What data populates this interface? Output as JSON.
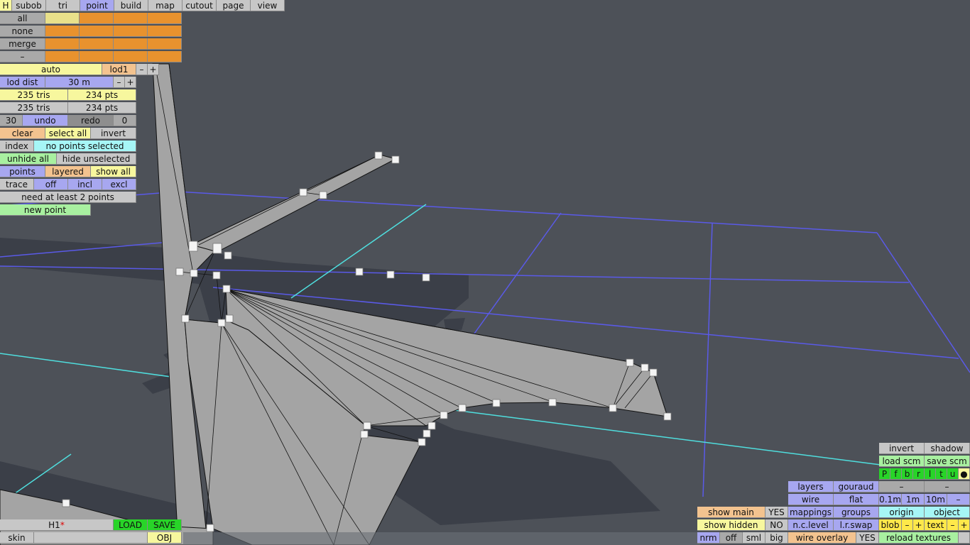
{
  "menu": {
    "h": "H",
    "tabs": [
      "subob",
      "tri",
      "point",
      "build",
      "map",
      "cutout",
      "page",
      "view"
    ],
    "active_tab": "point"
  },
  "selection": {
    "all": "all",
    "none": "none",
    "merge": "merge",
    "dash": "–"
  },
  "lod": {
    "auto": "auto",
    "lod1": "lod1",
    "minus": "–",
    "plus": "+",
    "dist_label": "lod dist",
    "dist_value": "30 m"
  },
  "stats": {
    "tris_a": "235 tris",
    "pts_a": "234 pts",
    "tris_b": "235 tris",
    "pts_b": "234 pts"
  },
  "undo": {
    "count": "30",
    "undo": "undo",
    "redo": "redo",
    "redo_count": "0"
  },
  "actions": {
    "clear": "clear",
    "select_all": "select all",
    "invert": "invert",
    "index": "index",
    "status": "no points selected",
    "unhide_all": "unhide all",
    "hide_unselected": "hide unselected",
    "points": "points",
    "layered": "layered",
    "show_all": "show all",
    "trace": "trace",
    "off": "off",
    "incl": "incl",
    "excl": "excl",
    "need_points": "need at least 2 points",
    "new_point": "new point"
  },
  "file": {
    "name": "H1",
    "modified": "*",
    "load": "LOAD",
    "save": "SAVE",
    "skin": "skin",
    "obj": "OBJ"
  },
  "view_options": {
    "show_main": "show main",
    "show_main_value": "YES",
    "show_hidden": "show hidden",
    "show_hidden_value": "NO",
    "nrm": "nrm",
    "off": "off",
    "sml": "sml",
    "big": "big",
    "layers": "layers",
    "gouraud": "gouraud",
    "wire": "wire",
    "flat": "flat",
    "mappings": "mappings",
    "groups": "groups",
    "nc_level": "n.c.level",
    "lr_swap": "l.r.swap",
    "wire_overlay": "wire overlay",
    "wire_overlay_value": "YES",
    "invert": "invert",
    "shadow": "shadow",
    "load_scm": "load scm",
    "save_scm": "save scm",
    "view_letters": [
      "P",
      "f",
      "b",
      "r",
      "l",
      "t",
      "u"
    ],
    "dot": "●",
    "dash1": "–",
    "dash2": "–",
    "grid_01": "0.1m",
    "grid_1": "1m",
    "grid_10": "10m",
    "grid_minus": "–",
    "origin": "origin",
    "object": "object",
    "blob": "blob",
    "blob_minus": "–",
    "blob_plus": "+",
    "text": "text",
    "text_minus": "–",
    "text_plus": "+",
    "reload_textures": "reload textures"
  }
}
